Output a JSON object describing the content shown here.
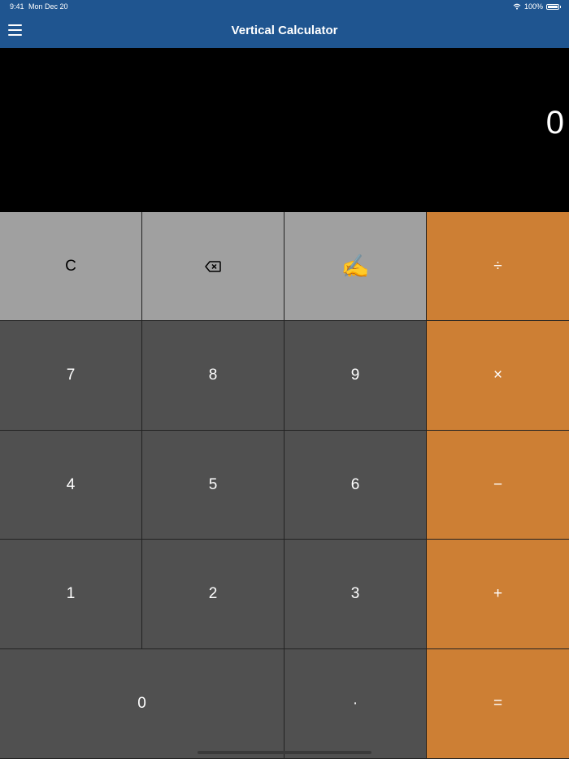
{
  "status": {
    "time": "9:41",
    "date": "Mon Dec 20",
    "battery": "100%"
  },
  "nav": {
    "title": "Vertical Calculator",
    "menu_icon": "hamburger-menu-icon"
  },
  "display": {
    "value": "0"
  },
  "keys": {
    "clear": "C",
    "backspace_icon": "backspace-icon",
    "handwriting": "✍️",
    "divide": "÷",
    "seven": "7",
    "eight": "8",
    "nine": "9",
    "multiply": "×",
    "four": "4",
    "five": "5",
    "six": "6",
    "minus": "−",
    "one": "1",
    "two": "2",
    "three": "3",
    "plus": "+",
    "zero": "0",
    "decimal": "·",
    "equals": "="
  },
  "colors": {
    "header": "#1f5590",
    "function_key": "#a0a0a0",
    "digit_key": "#505050",
    "operator_key": "#cd7f34",
    "display_bg": "#000000"
  }
}
